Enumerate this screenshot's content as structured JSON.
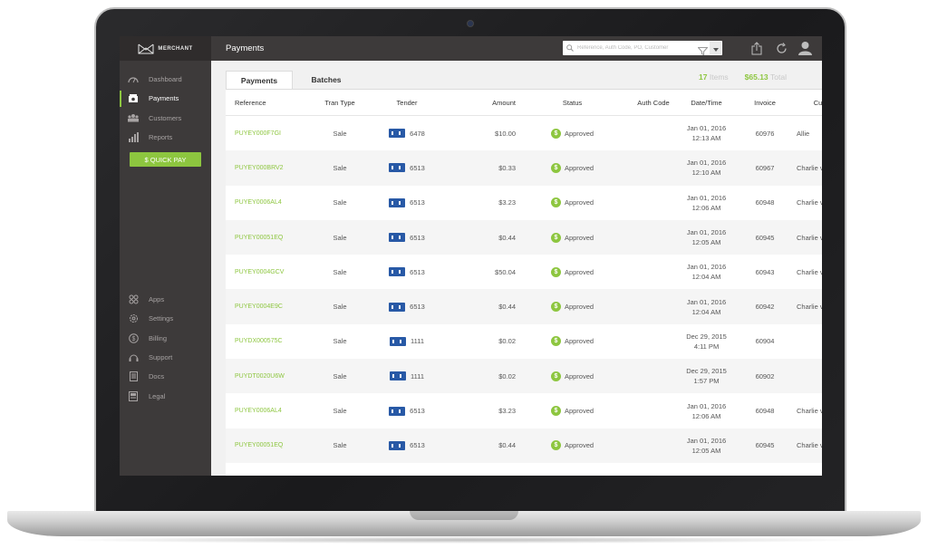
{
  "app": {
    "logo_text": "MERCHANT",
    "page_title": "Payments"
  },
  "sidebar": {
    "items": [
      {
        "label": "Dashboard",
        "icon": "gauge-icon"
      },
      {
        "label": "Payments",
        "icon": "money-icon"
      },
      {
        "label": "Customers",
        "icon": "people-icon"
      },
      {
        "label": "Reports",
        "icon": "bar-chart-icon"
      }
    ],
    "quick_pay_label": "$ QUICK PAY",
    "bottom_items": [
      {
        "label": "Apps",
        "icon": "apps-icon"
      },
      {
        "label": "Settings",
        "icon": "gear-icon"
      },
      {
        "label": "Billing",
        "icon": "dollar-icon"
      },
      {
        "label": "Support",
        "icon": "headset-icon"
      },
      {
        "label": "Docs",
        "icon": "doc-icon"
      },
      {
        "label": "Legal",
        "icon": "legal-icon"
      }
    ]
  },
  "search": {
    "placeholder": "Reference, Auth Code, PO, Customer"
  },
  "tabs": [
    "Payments",
    "Batches"
  ],
  "summary": {
    "count": "17",
    "count_label": "Items",
    "total": "$65.13",
    "total_label": "Total"
  },
  "table": {
    "headers": [
      "Reference",
      "Tran Type",
      "Tender",
      "Amount",
      "Status",
      "Auth Code",
      "Date/Time",
      "Invoice",
      "Customer"
    ],
    "rows": [
      {
        "ref": "PUYEY000F7GI",
        "type": "Sale",
        "card": "6478",
        "amount": "$10.00",
        "status": "Approved",
        "auth": "",
        "date": "Jan 01, 2016",
        "time": "12:13 AM",
        "invoice": "60976",
        "customer": "Allie"
      },
      {
        "ref": "PUYEY000BRV2",
        "type": "Sale",
        "card": "6513",
        "amount": "$0.33",
        "status": "Approved",
        "auth": "",
        "date": "Jan 01, 2016",
        "time": "12:10 AM",
        "invoice": "60967",
        "customer": "Charlie vault"
      },
      {
        "ref": "PUYEY0006AL4",
        "type": "Sale",
        "card": "6513",
        "amount": "$3.23",
        "status": "Approved",
        "auth": "",
        "date": "Jan 01, 2016",
        "time": "12:06 AM",
        "invoice": "60948",
        "customer": "Charlie vault"
      },
      {
        "ref": "PUYEY00051EQ",
        "type": "Sale",
        "card": "6513",
        "amount": "$0.44",
        "status": "Approved",
        "auth": "",
        "date": "Jan 01, 2016",
        "time": "12:05 AM",
        "invoice": "60945",
        "customer": "Charlie vault"
      },
      {
        "ref": "PUYEY0004GCV",
        "type": "Sale",
        "card": "6513",
        "amount": "$50.04",
        "status": "Approved",
        "auth": "",
        "date": "Jan 01, 2016",
        "time": "12:04 AM",
        "invoice": "60943",
        "customer": "Charlie vault"
      },
      {
        "ref": "PUYEY0004E9C",
        "type": "Sale",
        "card": "6513",
        "amount": "$0.44",
        "status": "Approved",
        "auth": "",
        "date": "Jan 01, 2016",
        "time": "12:04 AM",
        "invoice": "60942",
        "customer": "Charlie vault"
      },
      {
        "ref": "PUYDX000575C",
        "type": "Sale",
        "card": "1111",
        "amount": "$0.02",
        "status": "Approved",
        "auth": "",
        "date": "Dec 29, 2015",
        "time": "4:11 PM",
        "invoice": "60904",
        "customer": ""
      },
      {
        "ref": "PUYDT0020U6W",
        "type": "Sale",
        "card": "1111",
        "amount": "$0.02",
        "status": "Approved",
        "auth": "",
        "date": "Dec 29, 2015",
        "time": "1:57 PM",
        "invoice": "60902",
        "customer": ""
      },
      {
        "ref": "PUYEY0006AL4",
        "type": "Sale",
        "card": "6513",
        "amount": "$3.23",
        "status": "Approved",
        "auth": "",
        "date": "Jan 01, 2016",
        "time": "12:06 AM",
        "invoice": "60948",
        "customer": "Charlie vault"
      },
      {
        "ref": "PUYEY00051EQ",
        "type": "Sale",
        "card": "6513",
        "amount": "$0.44",
        "status": "Approved",
        "auth": "",
        "date": "Jan 01, 2016",
        "time": "12:05 AM",
        "invoice": "60945",
        "customer": "Charlie vault"
      }
    ]
  },
  "colors": {
    "accent": "#8dc63f",
    "sidebar": "#3d3a3a",
    "card": "#2859a6"
  }
}
